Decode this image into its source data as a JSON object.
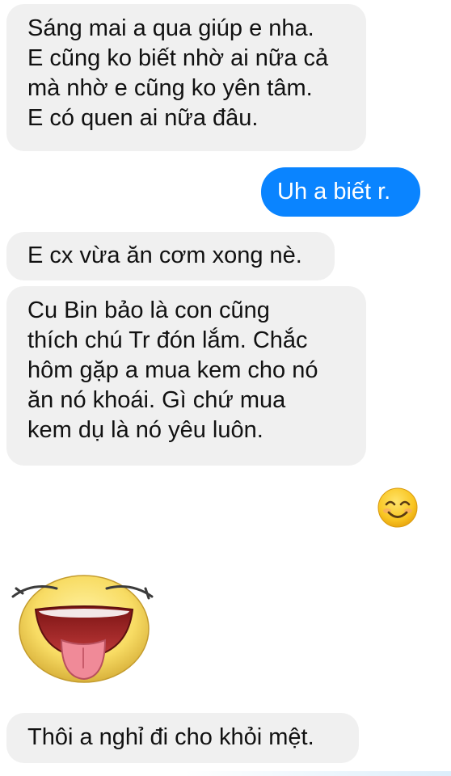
{
  "conversation": {
    "messages": [
      {
        "direction": "received",
        "text": "Sáng mai a qua giúp e nha.\nE cũng ko biết nhờ ai nữa cả\nmà nhờ e cũng ko yên tâm.\nE có quen ai nữa đâu."
      },
      {
        "direction": "sent",
        "text": "Uh a biết r."
      },
      {
        "direction": "received",
        "text": "E cx vừa ăn cơm xong nè."
      },
      {
        "direction": "received",
        "text": "Cu Bin bảo là con cũng\nthích chú Tr đón lắm. Chắc\nhôm gặp a mua kem cho nó\năn nó khoái. Gì chứ mua\nkem dụ là nó yêu luôn."
      },
      {
        "direction": "received",
        "text": "Thôi a nghỉ đi cho khỏi mệt."
      }
    ],
    "emoji_sent": "smiling-face-icon",
    "sticker_received": "tongue-out-laughing-face-icon"
  },
  "colors": {
    "received_bubble": "#f0f0f0",
    "sent_bubble": "#0a84ff",
    "emoji_yellow": "#f5c518"
  }
}
